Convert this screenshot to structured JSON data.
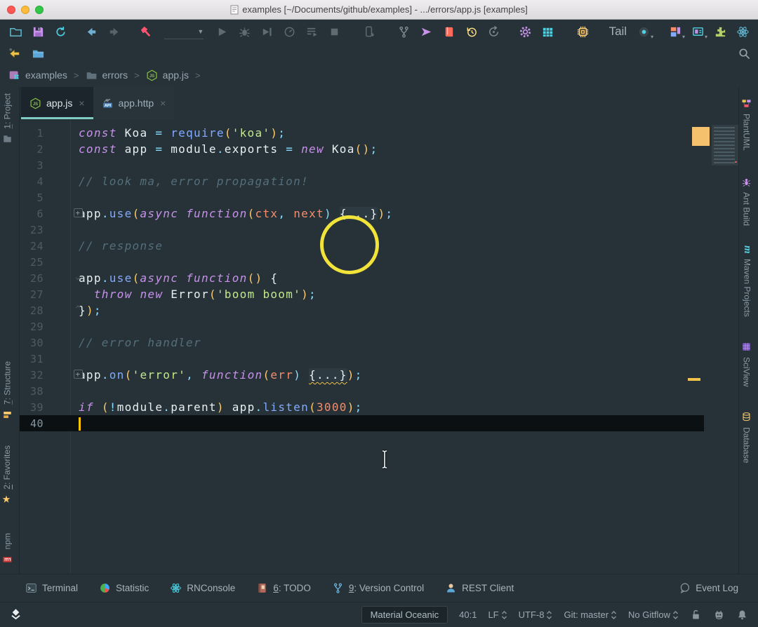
{
  "window": {
    "title": "examples [~/Documents/github/examples] - .../errors/app.js [examples]"
  },
  "toolbar": {
    "tail_label": "Tail",
    "run_config": {
      "value": ""
    },
    "icons_row1": [
      "open-folder-icon",
      "save-all-icon",
      "synchronize-icon",
      "back-icon",
      "forward-icon",
      "build-hammer-icon",
      "run-config-select",
      "run-icon",
      "debug-icon",
      "run-with-coverage-icon",
      "profiler-icon",
      "run-buffered-icon",
      "stop-icon",
      "attach-device-icon",
      "git-branch-icon",
      "send-icon",
      "reader-book-icon",
      "local-history-icon",
      "rollback-icon",
      "settings-gear-icon",
      "grid-icon",
      "cpu-chip-icon",
      "tail-button",
      "record-icon",
      "screens-icon",
      "monitor-db-icon",
      "plugin-puzzle-icon",
      "react-atom-icon"
    ],
    "icons_row2": [
      "yellow-back-arrow-icon",
      "blue-folder-icon",
      "search-icon"
    ]
  },
  "breadcrumbs": {
    "separator": ">",
    "items": [
      {
        "icon": "project-folder-icon",
        "label": "examples"
      },
      {
        "icon": "folder-icon",
        "label": "errors"
      },
      {
        "icon": "js-file-icon",
        "label": "app.js"
      }
    ]
  },
  "tabs": [
    {
      "icon": "js-file-icon",
      "label": "app.js",
      "close": "×",
      "active": true
    },
    {
      "icon": "api-file-icon",
      "label": "app.http",
      "close": "×",
      "active": false
    }
  ],
  "left_stripe": {
    "items": [
      {
        "num": "1",
        "rest": ": Project",
        "icon": "project-tool-icon"
      },
      {
        "num": "7",
        "rest": ": Structure",
        "icon": "structure-tool-icon"
      },
      {
        "num": "2",
        "rest": ": Favorites",
        "icon": "favorites-star-icon"
      },
      {
        "num": "",
        "rest": "npm",
        "icon": "npm-icon"
      }
    ]
  },
  "right_stripe": {
    "items": [
      {
        "label": "PlantUML",
        "icon": "plantuml-icon"
      },
      {
        "label": "Ant Build",
        "icon": "ant-build-icon"
      },
      {
        "label": "Maven Projects",
        "icon": "maven-icon"
      },
      {
        "label": "SciView",
        "icon": "sciview-icon"
      },
      {
        "label": "Database",
        "icon": "database-icon"
      }
    ]
  },
  "editor": {
    "lines": [
      {
        "n": "1",
        "t": [
          [
            "kw",
            "const"
          ],
          [
            "pl",
            " Koa "
          ],
          [
            "pu",
            "="
          ],
          [
            "pl",
            " "
          ],
          [
            "fn",
            "require"
          ],
          [
            "pa",
            "("
          ],
          [
            "st",
            "'koa'"
          ],
          [
            "pa",
            ")"
          ],
          [
            "pu",
            ";"
          ]
        ]
      },
      {
        "n": "2",
        "t": [
          [
            "kw",
            "const"
          ],
          [
            "pl",
            " app "
          ],
          [
            "pu",
            "="
          ],
          [
            "pl",
            " "
          ],
          [
            "pl",
            "module"
          ],
          [
            "pu",
            "."
          ],
          [
            "pl",
            "exports "
          ],
          [
            "pu",
            "="
          ],
          [
            "pl",
            " "
          ],
          [
            "kw",
            "new"
          ],
          [
            "pl",
            " Koa"
          ],
          [
            "pa",
            "()"
          ],
          [
            "pu",
            ";"
          ]
        ]
      },
      {
        "n": "3",
        "t": []
      },
      {
        "n": "4",
        "t": [
          [
            "cm",
            "// look ma, error propagation!"
          ]
        ]
      },
      {
        "n": "5",
        "t": []
      },
      {
        "n": "6",
        "fold": "plus",
        "t": [
          [
            "pl",
            "app"
          ],
          [
            "pu",
            "."
          ],
          [
            "fn",
            "use"
          ],
          [
            "pa",
            "("
          ],
          [
            "kw",
            "async"
          ],
          [
            "pl",
            " "
          ],
          [
            "kw",
            "function"
          ],
          [
            "pa",
            "("
          ],
          [
            "or",
            "ctx"
          ],
          [
            "pu",
            ","
          ],
          [
            "pl",
            " "
          ],
          [
            "or",
            "next"
          ],
          [
            "pu",
            ")"
          ],
          [
            "pl",
            " "
          ],
          [
            "fo",
            "{...}"
          ],
          [
            "pa",
            ")"
          ],
          [
            "pu",
            ";"
          ]
        ]
      },
      {
        "n": "23",
        "t": []
      },
      {
        "n": "24",
        "t": [
          [
            "cm",
            "// response"
          ]
        ]
      },
      {
        "n": "25",
        "t": []
      },
      {
        "n": "26",
        "fold": "top",
        "t": [
          [
            "pl",
            "app"
          ],
          [
            "pu",
            "."
          ],
          [
            "fn",
            "use"
          ],
          [
            "pa",
            "("
          ],
          [
            "kw",
            "async"
          ],
          [
            "pl",
            " "
          ],
          [
            "kw",
            "function"
          ],
          [
            "pa",
            "()"
          ],
          [
            "pl",
            " {"
          ]
        ]
      },
      {
        "n": "27",
        "t": [
          [
            "pl",
            "  "
          ],
          [
            "kw",
            "throw"
          ],
          [
            "pl",
            " "
          ],
          [
            "kw",
            "new"
          ],
          [
            "pl",
            " Error"
          ],
          [
            "pa",
            "("
          ],
          [
            "st",
            "'boom boom'"
          ],
          [
            "pa",
            ")"
          ],
          [
            "pu",
            ";"
          ]
        ]
      },
      {
        "n": "28",
        "fold": "bottom",
        "t": [
          [
            "pl",
            "}"
          ],
          [
            "pa",
            ")"
          ],
          [
            "pu",
            ";"
          ]
        ]
      },
      {
        "n": "29",
        "t": []
      },
      {
        "n": "30",
        "t": [
          [
            "cm",
            "// error handler"
          ]
        ]
      },
      {
        "n": "31",
        "t": []
      },
      {
        "n": "32",
        "fold": "plus",
        "t": [
          [
            "pl",
            "app"
          ],
          [
            "pu",
            "."
          ],
          [
            "fn",
            "on"
          ],
          [
            "pa",
            "("
          ],
          [
            "st",
            "'error'"
          ],
          [
            "pu",
            ","
          ],
          [
            "pl",
            " "
          ],
          [
            "kw",
            "function"
          ],
          [
            "pa",
            "("
          ],
          [
            "or",
            "err"
          ],
          [
            "pu",
            ")"
          ],
          [
            "pl",
            " "
          ],
          [
            "fw",
            "{...}"
          ],
          [
            "pa",
            ")"
          ],
          [
            "pu",
            ";"
          ]
        ]
      },
      {
        "n": "38",
        "t": []
      },
      {
        "n": "39",
        "t": [
          [
            "kw",
            "if"
          ],
          [
            "pl",
            " "
          ],
          [
            "pa",
            "("
          ],
          [
            "pu",
            "!"
          ],
          [
            "pl",
            "module"
          ],
          [
            "pu",
            "."
          ],
          [
            "pl",
            "parent"
          ],
          [
            "pa",
            ")"
          ],
          [
            "pl",
            " app"
          ],
          [
            "pu",
            "."
          ],
          [
            "fn",
            "listen"
          ],
          [
            "pa",
            "("
          ],
          [
            "or",
            "3000"
          ],
          [
            "pa",
            ")"
          ],
          [
            "pu",
            ";"
          ]
        ]
      },
      {
        "n": "40",
        "active": true,
        "caret": true,
        "t": []
      }
    ]
  },
  "bottom_bar": {
    "items": [
      {
        "num": "",
        "label": "Terminal",
        "icon": "terminal-icon"
      },
      {
        "num": "",
        "label": "Statistic",
        "icon": "statistic-pie-icon"
      },
      {
        "num": "",
        "label": "RNConsole",
        "icon": "react-console-icon"
      },
      {
        "num": "6",
        "label": ": TODO",
        "icon": "todo-book-icon"
      },
      {
        "num": "9",
        "label": ": Version Control",
        "icon": "version-control-branch-icon"
      },
      {
        "num": "",
        "label": "REST Client",
        "icon": "rest-client-person-icon"
      }
    ],
    "event_log": {
      "label": "Event Log",
      "icon": "event-log-bubble-icon"
    }
  },
  "status_bar": {
    "theme_popup": "Material Oceanic",
    "caret_position": "40:1",
    "line_separator": "LF",
    "encoding": "UTF-8",
    "git_branch": "Git: master",
    "gitflow": "No Gitflow",
    "icons": [
      "tool-window-layers-icon",
      "unlock-icon",
      "robot-icon",
      "notifications-bell-icon"
    ]
  }
}
